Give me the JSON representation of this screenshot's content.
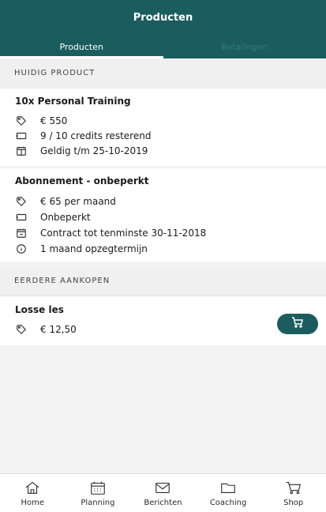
{
  "header": {
    "title": "Producten"
  },
  "tabs": [
    {
      "label": "Producten"
    },
    {
      "label": "Betalingen"
    }
  ],
  "sections": {
    "current": "HUIDIG PRODUCT",
    "previous": "EERDERE AANKOPEN"
  },
  "products": [
    {
      "title": "10x Personal Training",
      "lines": [
        "€ 550",
        "9 / 10 credits resterend",
        "Geldig t/m 25-10-2019"
      ]
    },
    {
      "title": "Abonnement - onbeperkt",
      "lines": [
        "€ 65 per maand",
        "Onbeperkt",
        "Contract tot tenminste 30-11-2018",
        "1 maand opzegtermijn"
      ]
    }
  ],
  "previous": [
    {
      "title": "Losse les",
      "lines": [
        "€ 12,50"
      ]
    }
  ],
  "nav": [
    {
      "label": "Home"
    },
    {
      "label": "Planning"
    },
    {
      "label": "Berichten"
    },
    {
      "label": "Coaching"
    },
    {
      "label": "Shop"
    }
  ]
}
